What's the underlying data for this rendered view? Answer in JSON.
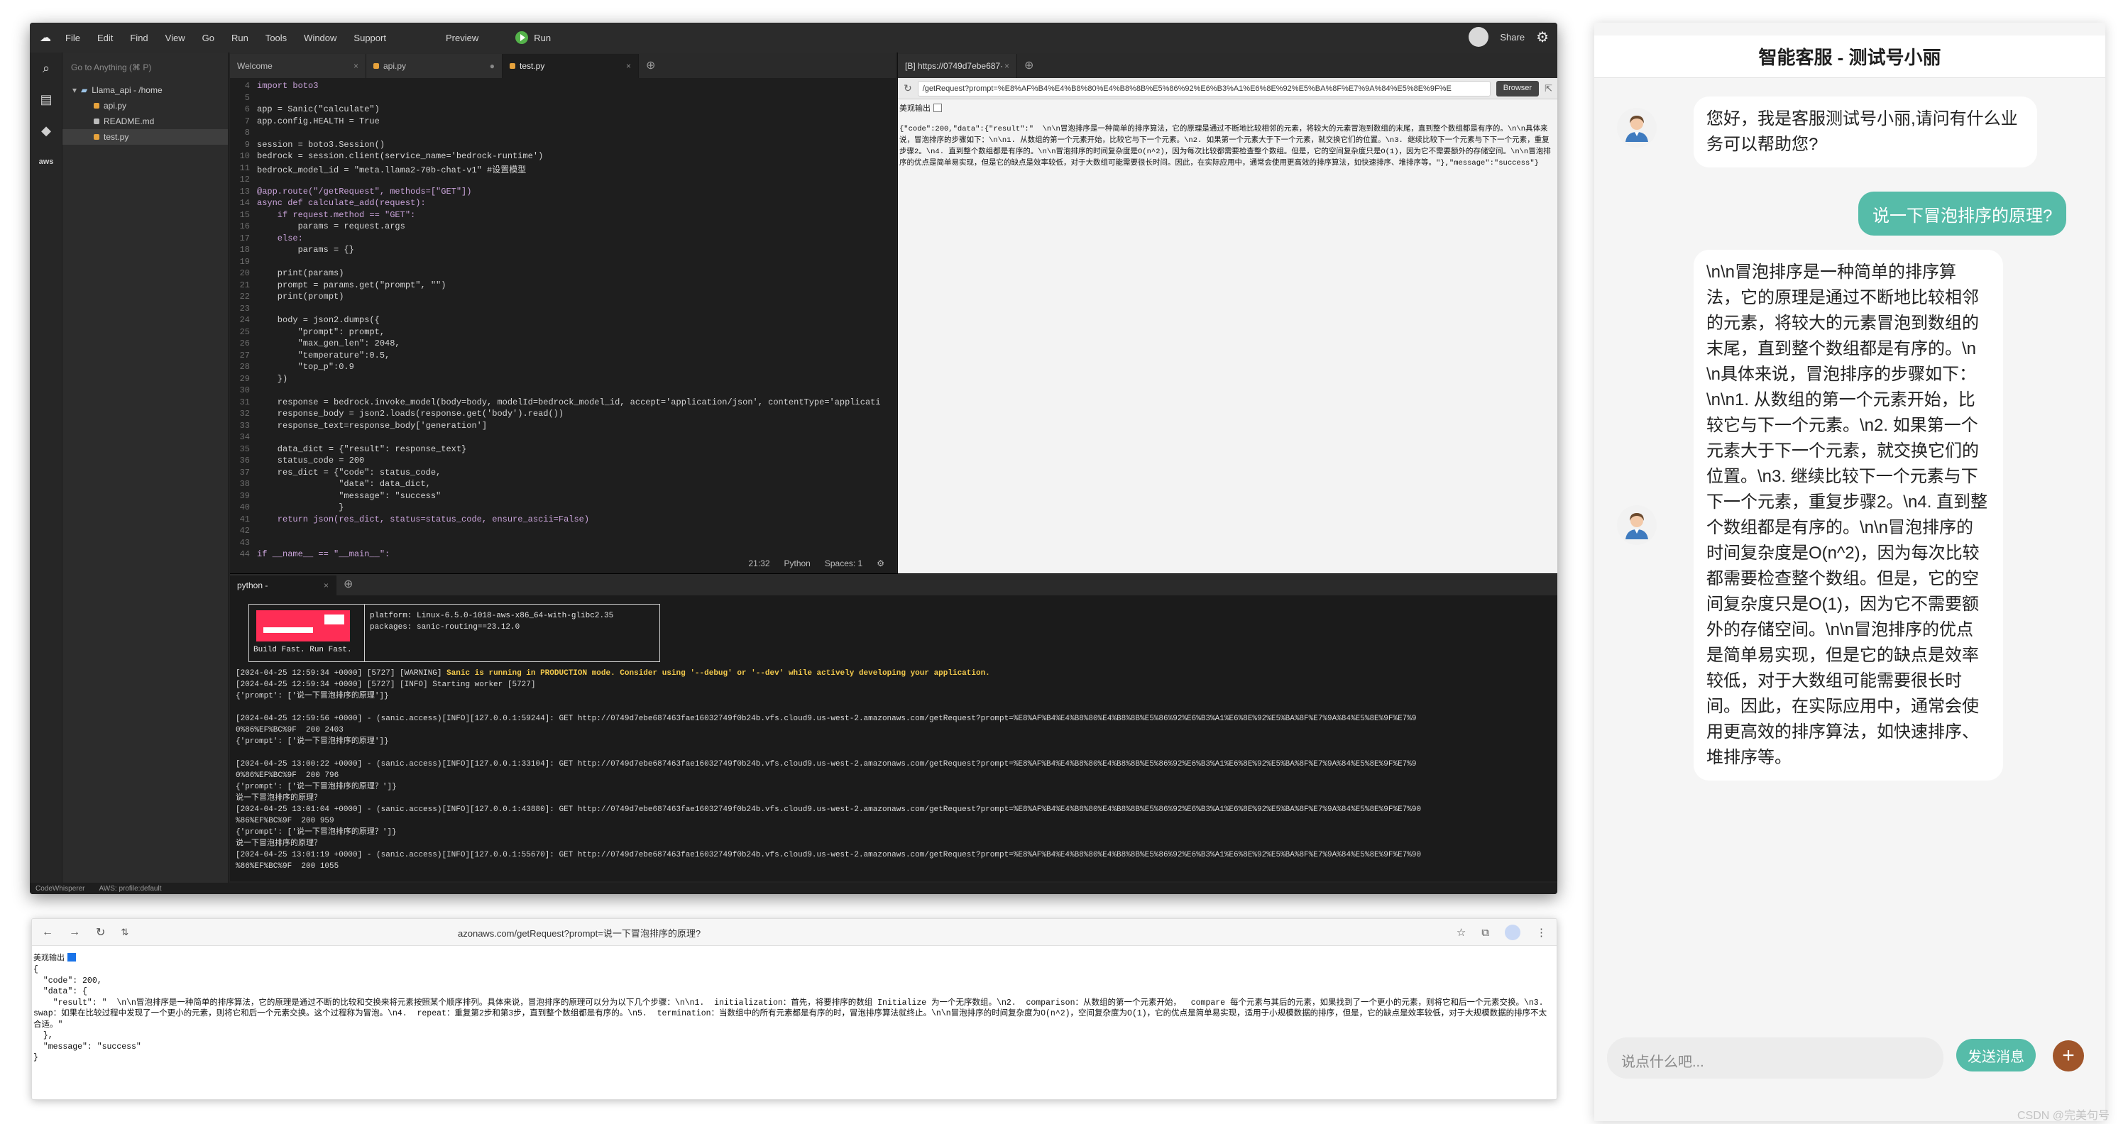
{
  "ide": {
    "menu": [
      "File",
      "Edit",
      "Find",
      "View",
      "Go",
      "Run",
      "Tools",
      "Window",
      "Support"
    ],
    "preview_label": "Preview",
    "run_label": "Run",
    "share_label": "Share",
    "goto_placeholder": "Go to Anything (⌘ P)",
    "tree": {
      "root": "Llama_api - /home",
      "files": [
        "api.py",
        "README.md",
        "test.py"
      ]
    },
    "tabs": [
      "Welcome",
      "api.py",
      "test.py"
    ],
    "code_lines": [
      {
        "n": "4",
        "t": "import boto3"
      },
      {
        "n": "5",
        "t": ""
      },
      {
        "n": "6",
        "t": "app = Sanic(\"calculate\")"
      },
      {
        "n": "7",
        "t": "app.config.HEALTH = True"
      },
      {
        "n": "8",
        "t": ""
      },
      {
        "n": "9",
        "t": "session = boto3.Session()"
      },
      {
        "n": "10",
        "t": "bedrock = session.client(service_name='bedrock-runtime')"
      },
      {
        "n": "11",
        "t": "bedrock_model_id = \"meta.llama2-70b-chat-v1\" #设置模型"
      },
      {
        "n": "12",
        "t": ""
      },
      {
        "n": "13",
        "t": "@app.route(\"/getRequest\", methods=[\"GET\"])"
      },
      {
        "n": "14",
        "t": "async def calculate_add(request):"
      },
      {
        "n": "15",
        "t": "    if request.method == \"GET\":"
      },
      {
        "n": "16",
        "t": "        params = request.args"
      },
      {
        "n": "17",
        "t": "    else:"
      },
      {
        "n": "18",
        "t": "        params = {}"
      },
      {
        "n": "19",
        "t": ""
      },
      {
        "n": "20",
        "t": "    print(params)"
      },
      {
        "n": "21",
        "t": "    prompt = params.get(\"prompt\", \"\")"
      },
      {
        "n": "22",
        "t": "    print(prompt)"
      },
      {
        "n": "23",
        "t": ""
      },
      {
        "n": "24",
        "t": "    body = json2.dumps({"
      },
      {
        "n": "25",
        "t": "        \"prompt\": prompt,"
      },
      {
        "n": "26",
        "t": "        \"max_gen_len\": 2048,"
      },
      {
        "n": "27",
        "t": "        \"temperature\":0.5,"
      },
      {
        "n": "28",
        "t": "        \"top_p\":0.9"
      },
      {
        "n": "29",
        "t": "    })"
      },
      {
        "n": "30",
        "t": ""
      },
      {
        "n": "31",
        "t": "    response = bedrock.invoke_model(body=body, modelId=bedrock_model_id, accept='application/json', contentType='applicati"
      },
      {
        "n": "32",
        "t": "    response_body = json2.loads(response.get('body').read())"
      },
      {
        "n": "33",
        "t": "    response_text=response_body['generation']"
      },
      {
        "n": "34",
        "t": ""
      },
      {
        "n": "35",
        "t": "    data_dict = {\"result\": response_text}"
      },
      {
        "n": "36",
        "t": "    status_code = 200"
      },
      {
        "n": "37",
        "t": "    res_dict = {\"code\": status_code,"
      },
      {
        "n": "38",
        "t": "                \"data\": data_dict,"
      },
      {
        "n": "39",
        "t": "                \"message\": \"success\""
      },
      {
        "n": "40",
        "t": "                }"
      },
      {
        "n": "41",
        "t": "    return json(res_dict, status=status_code, ensure_ascii=False)"
      },
      {
        "n": "42",
        "t": ""
      },
      {
        "n": "43",
        "t": ""
      },
      {
        "n": "44",
        "t": "if __name__ == \"__main__\":"
      }
    ],
    "status": {
      "pos": "21:32",
      "lang": "Python",
      "spaces": "Spaces: 1"
    },
    "preview": {
      "tab": "[B] https://0749d7ebe687·",
      "url": "/getRequest?prompt=%E8%AF%B4%E4%B8%80%E4%B8%8B%E5%86%92%E6%B3%A1%E6%8E%92%E5%BA%8F%E7%9A%84%E5%8E%9F%E",
      "browser_btn": "Browser",
      "checkbox_label": "美观输出",
      "json": "{\"code\":200,\"data\":{\"result\":\"  \\n\\n冒泡排序是一种简单的排序算法，它的原理是通过不断地比较相邻的元素，将较大的元素冒泡到数组的末尾，直到整个数组都是有序的。\\n\\n具体来说，冒泡排序的步骤如下：\\n\\n1. 从数组的第一个元素开始，比较它与下一个元素。\\n2. 如果第一个元素大于下一个元素，就交换它们的位置。\\n3. 继续比较下一个元素与下下一个元素，重复步骤2。\\n4. 直到整个数组都是有序的。\\n\\n冒泡排序的时间复杂度是O(n^2)，因为每次比较都需要检查整个数组。但是，它的空间复杂度只是O(1)，因为它不需要额外的存储空间。\\n\\n冒泡排序的优点是简单易实现，但是它的缺点是效率较低，对于大数组可能需要很长时间。因此，在实际应用中，通常会使用更高效的排序算法，如快速排序、堆排序等。\"},\"message\":\"success\"}"
    },
    "terminal": {
      "tab": "python -",
      "banner_caption": "Build Fast. Run Fast.",
      "banner_info": "platform: Linux-6.5.0-1018-aws-x86_64-with-glibc2.35\npackages: sanic-routing==23.12.0",
      "log_warn_prefix": "[2024-04-25 12:59:34 +0000] [5727] [WARNING] ",
      "log_warn": "Sanic is running in PRODUCTION mode. Consider using '--debug' or '--dev' while actively developing your application.",
      "logs": "[2024-04-25 12:59:34 +0000] [5727] [INFO] Starting worker [5727]\n{'prompt': ['说一下冒泡排序的原理']}\n\n[2024-04-25 12:59:56 +0000] - (sanic.access)[INFO][127.0.0.1:59244]: GET http://0749d7ebe687463fae16032749f0b24b.vfs.cloud9.us-west-2.amazonaws.com/getRequest?prompt=%E8%AF%B4%E4%B8%80%E4%B8%8B%E5%86%92%E6%B3%A1%E6%8E%92%E5%BA%8F%E7%9A%84%E5%8E%9F%E7%9\n0%86%EF%BC%9F  200 2403\n{'prompt': ['说一下冒泡排序的原理']}\n\n[2024-04-25 13:00:22 +0000] - (sanic.access)[INFO][127.0.0.1:33104]: GET http://0749d7ebe687463fae16032749f0b24b.vfs.cloud9.us-west-2.amazonaws.com/getRequest?prompt=%E8%AF%B4%E4%B8%80%E4%B8%8B%E5%86%92%E6%B3%A1%E6%8E%92%E5%BA%8F%E7%9A%84%E5%8E%9F%E7%9\n0%86%EF%BC%9F  200 796\n{'prompt': ['说一下冒泡排序的原理？']}\n说一下冒泡排序的原理？\n[2024-04-25 13:01:04 +0000] - (sanic.access)[INFO][127.0.0.1:43880]: GET http://0749d7ebe687463fae16032749f0b24b.vfs.cloud9.us-west-2.amazonaws.com/getRequest?prompt=%E8%AF%B4%E4%B8%80%E4%B8%8B%E5%86%92%E6%B3%A1%E6%8E%92%E5%BA%8F%E7%9A%84%E5%8E%9F%E7%90\n%86%EF%BC%9F  200 959\n{'prompt': ['说一下冒泡排序的原理？']}\n说一下冒泡排序的原理？\n[2024-04-25 13:01:19 +0000] - (sanic.access)[INFO][127.0.0.1:55670]: GET http://0749d7ebe687463fae16032749f0b24b.vfs.cloud9.us-west-2.amazonaws.com/getRequest?prompt=%E8%AF%B4%E4%B8%80%E4%B8%8B%E5%86%92%E6%B3%A1%E6%8E%92%E5%BA%8F%E7%9A%84%E5%8E%9F%E7%90\n%86%EF%BC%9F  200 1055"
    },
    "bottom": [
      "CodeWhisperer",
      "AWS: profile:default"
    ]
  },
  "browser": {
    "url": "azonaws.com/getRequest?prompt=说一下冒泡排序的原理?",
    "checkbox_label": "美观输出",
    "json": "{\n  \"code\": 200,\n  \"data\": {\n    \"result\": \"  \\n\\n冒泡排序是一种简单的排序算法，它的原理是通过不断的比较和交换来将元素按照某个顺序排列。具体来说，冒泡排序的原理可以分为以下几个步骤：\\n\\n1.  initialization：首先，将要排序的数组 Initialize 为一个无序数组。\\n2.  comparison：从数组的第一个元素开始，  compare 每个元素与其后的元素，如果找到了一个更小的元素，则将它和后一个元素交换。\\n3.  swap：如果在比较过程中发现了一个更小的元素，则将它和后一个元素交换。这个过程称为冒泡。\\n4.  repeat：重复第2步和第3步，直到整个数组都是有序的。\\n5.  termination：当数组中的所有元素都是有序的时，冒泡排序算法就终止。\\n\\n冒泡排序的时间复杂度为O(n^2)，空间复杂度为O(1)，它的优点是简单易实现，适用于小规模数据的排序，但是，它的缺点是效率较低，对于大规模数据的排序不太合适。\"\n  },\n  \"message\": \"success\"\n}"
  },
  "chat": {
    "title": "智能客服 - 测试号小丽",
    "greeting": "您好，我是客服测试号小丽,请问有什么业务可以帮助您?",
    "user_message": "说一下冒泡排序的原理?",
    "reply": "\\n\\n冒泡排序是一种简单的排序算法，它的原理是通过不断地比较相邻的元素，将较大的元素冒泡到数组的末尾，直到整个数组都是有序的。\\n\\n具体来说，冒泡排序的步骤如下：\\n\\n1. 从数组的第一个元素开始，比较它与下一个元素。\\n2. 如果第一个元素大于下一个元素，就交换它们的位置。\\n3. 继续比较下一个元素与下下一个元素，重复步骤2。\\n4. 直到整个数组都是有序的。\\n\\n冒泡排序的时间复杂度是O(n^2)，因为每次比较都需要检查整个数组。但是，它的空间复杂度只是O(1)，因为它不需要额外的存储空间。\\n\\n冒泡排序的优点是简单易实现，但是它的缺点是效率较低，对于大数组可能需要很长时间。因此，在实际应用中，通常会使用更高效的排序算法，如快速排序、堆排序等。",
    "input_placeholder": "说点什么吧...",
    "send_label": "发送消息",
    "plus_label": "+",
    "accent": "#56bca9"
  },
  "watermark": "CSDN @完美句号"
}
